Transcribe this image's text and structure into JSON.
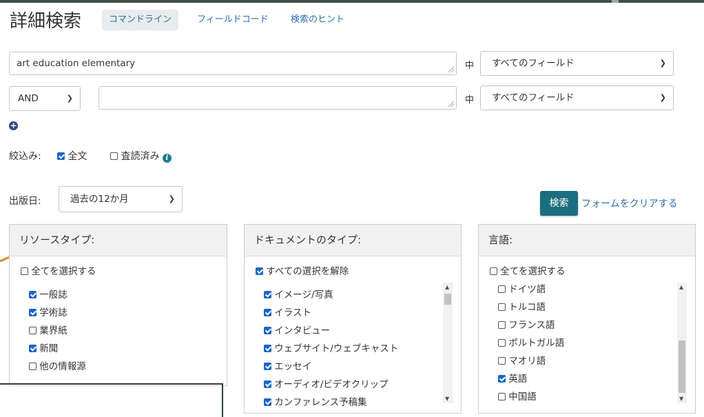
{
  "header": {
    "title": "詳細検索",
    "tabs": [
      "コマンドライン",
      "フィールドコード",
      "検索のヒント"
    ]
  },
  "query_rows": [
    {
      "value": "art education elementary",
      "in_label": "中",
      "field": "すべてのフィールド"
    },
    {
      "operator": "AND",
      "value": "",
      "in_label": "中",
      "field": "すべてのフィールド"
    }
  ],
  "add_row_icon": "plus-circle-icon",
  "limiters": {
    "label": "絞込み:",
    "fulltext": {
      "label": "全文",
      "checked": true
    },
    "peer_reviewed": {
      "label": "査読済み",
      "checked": false
    },
    "info_icon": "i"
  },
  "pub_date": {
    "label": "出版日:",
    "value": "過去の12か月"
  },
  "actions": {
    "search": "検索",
    "clear": "フォームをクリアする"
  },
  "resource_type": {
    "title": "リソースタイプ:",
    "select_all": "全てを選択する",
    "items": [
      {
        "label": "一般誌",
        "checked": true
      },
      {
        "label": "学術誌",
        "checked": true
      },
      {
        "label": "業界紙",
        "checked": false
      },
      {
        "label": "新聞",
        "checked": true
      },
      {
        "label": "他の情報源",
        "checked": false
      }
    ]
  },
  "document_type": {
    "title": "ドキュメントのタイプ:",
    "select_all": "すべての選択を解除",
    "items": [
      {
        "label": "イメージ/写真",
        "checked": true
      },
      {
        "label": "イラスト",
        "checked": true
      },
      {
        "label": "インタビュー",
        "checked": true
      },
      {
        "label": "ウェブサイト/ウェブキャスト",
        "checked": true
      },
      {
        "label": "エッセイ",
        "checked": true
      },
      {
        "label": "オーディオ/ビデオクリップ",
        "checked": true
      },
      {
        "label": "カンファレンス予稿集",
        "checked": true
      }
    ]
  },
  "language": {
    "title": "言語:",
    "select_all": "全てを選択する",
    "items": [
      {
        "label": "ドイツ語",
        "checked": false
      },
      {
        "label": "トルコ語",
        "checked": false
      },
      {
        "label": "フランス語",
        "checked": false
      },
      {
        "label": "ポルトガル語",
        "checked": false
      },
      {
        "label": "マオリ語",
        "checked": false
      },
      {
        "label": "英語",
        "checked": true
      },
      {
        "label": "中国語",
        "checked": false
      }
    ]
  },
  "colors": {
    "accent": "#1b6e7e",
    "link": "#2b6cb0",
    "checkbox": "#1a66c9",
    "arrow": "#e08a2c"
  }
}
